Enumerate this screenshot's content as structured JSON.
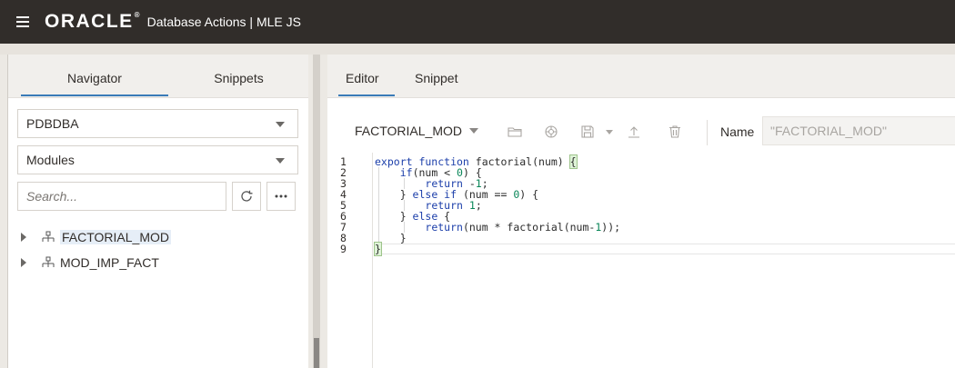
{
  "app": {
    "logo": "ORACLE",
    "title": "Database Actions | MLE JS"
  },
  "colors": {
    "topbar": "#312d2a",
    "accent": "#3a7bb8",
    "keyword": "#1c3faa",
    "number": "#098658"
  },
  "left_panel": {
    "tabs": [
      {
        "label": "Navigator",
        "active": true
      },
      {
        "label": "Snippets",
        "active": false
      }
    ],
    "schema_select": "PDBDBA",
    "object_type_select": "Modules",
    "search_placeholder": "Search...",
    "tree": [
      {
        "label": "FACTORIAL_MOD",
        "selected": true,
        "icon": "module-icon"
      },
      {
        "label": "MOD_IMP_FACT",
        "selected": false,
        "icon": "module-icon"
      }
    ]
  },
  "right_panel": {
    "tabs": [
      {
        "label": "Editor",
        "active": true
      },
      {
        "label": "Snippet",
        "active": false
      }
    ],
    "toolbar": {
      "module_select": "FACTORIAL_MOD",
      "icons": [
        "open-folder-icon",
        "environment-icon",
        "save-icon",
        "save-dropdown-icon",
        "upload-icon",
        "delete-icon"
      ],
      "name_label": "Name",
      "name_value": "\"FACTORIAL_MOD\""
    },
    "code": {
      "line_numbers": [
        "1",
        "2",
        "3",
        "4",
        "5",
        "6",
        "7",
        "8",
        "9"
      ],
      "lines": [
        "export function factorial(num) {",
        "    if(num < 0) {",
        "        return -1;",
        "    } else if (num == 0) {",
        "        return 1;",
        "    } else {",
        "        return(num * factorial(num-1));",
        "    }",
        "}"
      ]
    }
  }
}
